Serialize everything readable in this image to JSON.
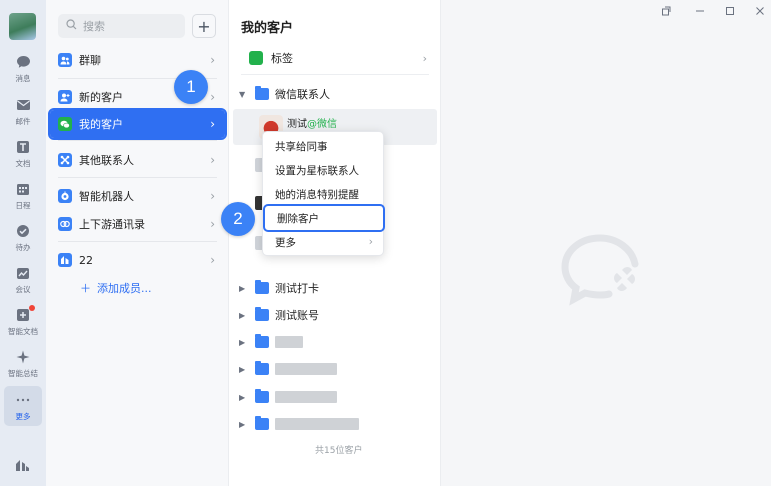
{
  "rail": {
    "items": [
      {
        "label": "消息",
        "icon": "chat-bubble-icon"
      },
      {
        "label": "邮件",
        "icon": "mail-icon"
      },
      {
        "label": "文档",
        "icon": "document-icon"
      },
      {
        "label": "日程",
        "icon": "calendar-icon"
      },
      {
        "label": "待办",
        "icon": "todo-check-icon"
      },
      {
        "label": "会议",
        "icon": "meeting-icon"
      },
      {
        "label": "智能文档",
        "icon": "smart-doc-icon"
      },
      {
        "label": "智能总结",
        "icon": "sparkle-icon"
      },
      {
        "label": "更多",
        "icon": "more-dots-icon"
      }
    ]
  },
  "nav": {
    "search_placeholder": "搜索",
    "add_label": "+",
    "items": [
      {
        "label": "群聊",
        "color": "#3b82f6"
      },
      {
        "label": "新的客户",
        "color": "#3b82f6"
      },
      {
        "label": "我的客户",
        "color": "#22b14c"
      },
      {
        "label": "其他联系人",
        "color": "#3b82f6"
      },
      {
        "label": "智能机器人",
        "color": "#3b82f6"
      },
      {
        "label": "上下游通讯录",
        "color": "#3b82f6"
      },
      {
        "label": "22",
        "color": "#3b82f6"
      }
    ],
    "add_member": "添加成员..."
  },
  "mid": {
    "title": "我的客户",
    "tag_label": "标签",
    "group_label": "微信联系人",
    "contact": {
      "name": "测试",
      "source": "@微信"
    },
    "groups": [
      {
        "label": "测试打卡"
      },
      {
        "label": "测试账号"
      }
    ],
    "footer": "共15位客户"
  },
  "context_menu": {
    "items": [
      "共享给同事",
      "设置为星标联系人",
      "她的消息特别提醒",
      "删除客户",
      "更多"
    ]
  },
  "badges": {
    "step1": "1",
    "step2": "2"
  },
  "colors": {
    "accent": "#2f6ff2",
    "wechat_green": "#22b14c"
  }
}
